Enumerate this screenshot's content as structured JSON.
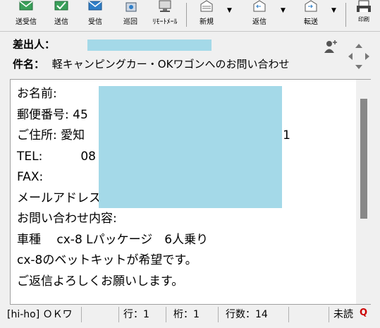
{
  "toolbar": {
    "items": [
      {
        "label": "送受信",
        "icon": "send-receive-icon"
      },
      {
        "label": "送信",
        "icon": "send-icon"
      },
      {
        "label": "受信",
        "icon": "receive-icon"
      },
      {
        "label": "巡回",
        "icon": "patrol-icon"
      },
      {
        "label": "ﾘﾓｰﾄﾒｰﾙ",
        "icon": "remote-mail-icon"
      },
      {
        "label": "新規",
        "icon": "new-mail-icon"
      },
      {
        "label": "返信",
        "icon": "reply-icon"
      },
      {
        "label": "転送",
        "icon": "forward-icon"
      },
      {
        "label": "印刷",
        "icon": "print-icon"
      }
    ]
  },
  "header": {
    "from_label": "差出人：",
    "subject_label": "件名：",
    "subject": "軽キャンピングカー・OKワゴンへのお問い合わせ"
  },
  "message": {
    "lines": [
      "お名前:",
      "郵便番号: 45",
      "ご住所: 愛知                                                    1",
      "TEL:          08",
      "FAX:",
      "メールアドレス:",
      "お問い合わせ内容:",
      "車種　 cx-8 Lパッケージ　6人乗り",
      "cx-8のベットキットが希望です。",
      "ご返信よろしくお願いします。"
    ]
  },
  "status": {
    "account": "[hi-ho] ＯＫワ",
    "row": "行：1",
    "col": "桁：1",
    "lines": "行数：14",
    "unread": "未読"
  },
  "colors": {
    "redaction": "#a4d9e8",
    "toolbar_bg": "#f0f0f0"
  }
}
